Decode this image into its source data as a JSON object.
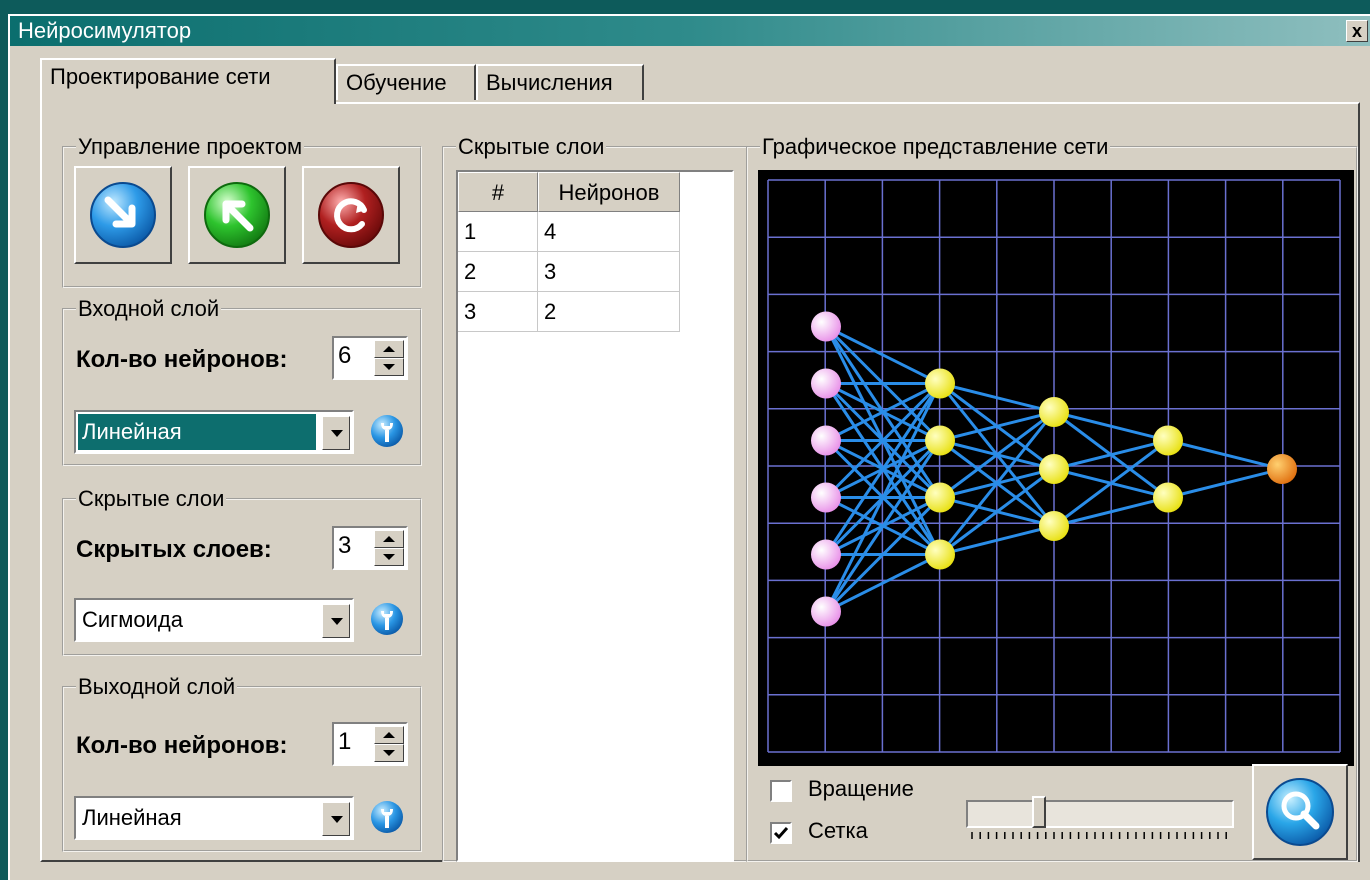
{
  "window": {
    "title": "Нейросимулятор",
    "close_glyph": "x"
  },
  "tabs": [
    {
      "label": "Проектирование сети",
      "active": true
    },
    {
      "label": "Обучение",
      "active": false
    },
    {
      "label": "Вычисления",
      "active": false
    }
  ],
  "project": {
    "legend": "Управление проектом",
    "buttons": [
      {
        "name": "open-project-button",
        "icon": "arrow-down-right-icon",
        "color": "#1e8fe0"
      },
      {
        "name": "save-project-button",
        "icon": "arrow-up-left-icon",
        "color": "#22b522"
      },
      {
        "name": "reset-project-button",
        "icon": "refresh-icon",
        "color": "#a01818"
      }
    ]
  },
  "input_layer": {
    "legend": "Входной слой",
    "label": "Кол-во нейронов:",
    "value": "6",
    "activation": "Линейная",
    "activation_selected": true
  },
  "hidden_layers": {
    "legend": "Скрытые слои",
    "label": "Скрытых слоев:",
    "value": "3",
    "activation": "Сигмоида"
  },
  "output_layer": {
    "legend": "Выходной слой",
    "label": "Кол-во нейронов:",
    "value": "1",
    "activation": "Линейная"
  },
  "hidden_table": {
    "legend": "Скрытые слои",
    "headers": [
      "#",
      "Нейронов"
    ],
    "rows": [
      {
        "n": "1",
        "neurons": "4"
      },
      {
        "n": "2",
        "neurons": "3"
      },
      {
        "n": "3",
        "neurons": "2"
      }
    ]
  },
  "graph": {
    "legend": "Графическое представление сети",
    "layers": [
      6,
      4,
      3,
      2,
      1
    ],
    "grid": true,
    "colors": {
      "input": "#f2a6f2",
      "hidden": "#f2f21a",
      "output": "#f0a020",
      "edge": "#2a8de8",
      "grid": "#6a70d0",
      "background": "#000000"
    },
    "rotation_label": "Вращение",
    "rotation_checked": false,
    "grid_label": "Сетка",
    "grid_checked": true,
    "slider_fraction": 0.26,
    "zoom_icon": "magnifier-icon"
  }
}
